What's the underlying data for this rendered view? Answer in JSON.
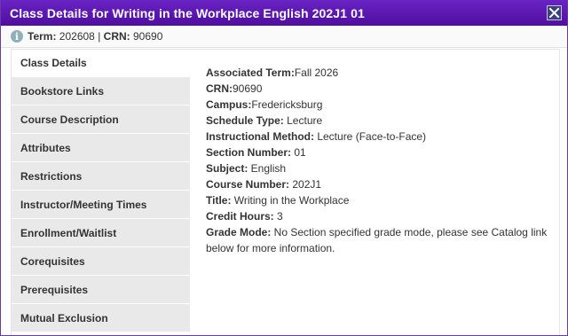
{
  "dialog": {
    "title": "Class Details for Writing in the Workplace English 202J1 01",
    "close_icon": "close-icon"
  },
  "info": {
    "term_label": "Term:",
    "term_value": "202608",
    "separator": "|",
    "crn_label": "CRN:",
    "crn_value": "90690"
  },
  "nav": [
    {
      "label": "Class Details",
      "active": true
    },
    {
      "label": "Bookstore Links"
    },
    {
      "label": "Course Description"
    },
    {
      "label": "Attributes"
    },
    {
      "label": "Restrictions"
    },
    {
      "label": "Instructor/Meeting Times"
    },
    {
      "label": "Enrollment/Waitlist"
    },
    {
      "label": "Corequisites"
    },
    {
      "label": "Prerequisites"
    },
    {
      "label": "Mutual Exclusion"
    }
  ],
  "details": [
    {
      "label": "Associated Term:",
      "value": "Fall 2026"
    },
    {
      "label": "CRN:",
      "value": "90690"
    },
    {
      "label": "Campus:",
      "value": "Fredericksburg"
    },
    {
      "label": "Schedule Type:",
      "value": " Lecture"
    },
    {
      "label": "Instructional Method:",
      "value": " Lecture (Face-to-Face)"
    },
    {
      "label": "Section Number:",
      "value": " 01"
    },
    {
      "label": "Subject:",
      "value": " English"
    },
    {
      "label": "Course Number:",
      "value": " 202J1"
    },
    {
      "label": "Title:",
      "value": " Writing in the Workplace"
    },
    {
      "label": "Credit Hours:",
      "value": " 3"
    },
    {
      "label": "Grade Mode:",
      "value": " No Section specified grade mode, please see Catalog link below for more information."
    }
  ]
}
